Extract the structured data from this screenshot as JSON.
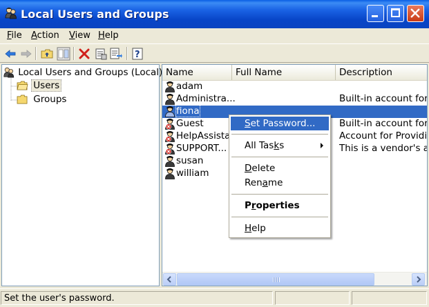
{
  "window": {
    "title": "Local Users and Groups"
  },
  "menubar": [
    {
      "pre": "",
      "key": "F",
      "post": "ile"
    },
    {
      "pre": "",
      "key": "A",
      "post": "ction"
    },
    {
      "pre": "",
      "key": "V",
      "post": "iew"
    },
    {
      "pre": "",
      "key": "H",
      "post": "elp"
    }
  ],
  "toolbar": {
    "icons": [
      "back-arrow-icon",
      "forward-arrow-icon",
      "up-folder-icon",
      "show-hide-tree-icon",
      "delete-icon",
      "properties-icon",
      "export-list-icon",
      "help-icon"
    ]
  },
  "tree": {
    "root": "Local Users and Groups (Local)",
    "children": [
      "Users",
      "Groups"
    ],
    "selected": "Users"
  },
  "list": {
    "columns": [
      "Name",
      "Full Name",
      "Description"
    ],
    "rows": [
      {
        "name": "adam",
        "full_name": "",
        "description": "",
        "disabled": false
      },
      {
        "name": "Administra...",
        "full_name": "",
        "description": "Built-in account for a",
        "disabled": false
      },
      {
        "name": "fiona",
        "full_name": "",
        "description": "",
        "disabled": false,
        "selected": true
      },
      {
        "name": "Guest",
        "full_name": "",
        "description": "Built-in account for g",
        "disabled": true
      },
      {
        "name": "HelpAssista...",
        "full_name": "",
        "description": "Account for Providin",
        "disabled": true
      },
      {
        "name": "SUPPORT...",
        "full_name": "",
        "description": "This is a vendor's acc",
        "disabled": true
      },
      {
        "name": "susan",
        "full_name": "",
        "description": "",
        "disabled": false
      },
      {
        "name": "william",
        "full_name": "",
        "description": "",
        "disabled": false
      }
    ]
  },
  "context_menu": {
    "items": [
      {
        "pre": "",
        "key": "S",
        "post": "et Password...",
        "highlighted": true
      },
      {
        "pre": "All Tas",
        "key": "k",
        "post": "s",
        "submenu": true
      },
      {
        "pre": "",
        "key": "D",
        "post": "elete"
      },
      {
        "pre": "Ren",
        "key": "a",
        "post": "me"
      },
      {
        "pre": "P",
        "key": "r",
        "post": "operties",
        "bold": true
      },
      {
        "pre": "",
        "key": "H",
        "post": "elp"
      }
    ]
  },
  "status": {
    "text": "Set the user's password."
  },
  "colors": {
    "selection": "#316AC5",
    "titlebar": "#0A44C0",
    "face": "#ECE9D8"
  }
}
